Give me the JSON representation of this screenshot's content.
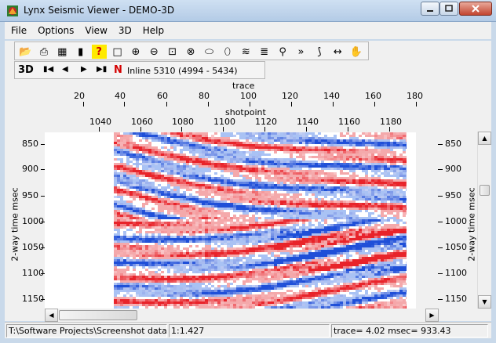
{
  "window": {
    "title": "Lynx Seismic Viewer - DEMO-3D"
  },
  "menu": [
    "File",
    "Options",
    "View",
    "3D",
    "Help"
  ],
  "toolbar": {
    "buttons": [
      "open-icon",
      "print-icon",
      "export-icon",
      "colorbar-icon",
      "help-icon",
      "new-window-icon",
      "zoom-in-icon",
      "zoom-out-icon",
      "zoom-box-icon",
      "zoom-cancel-icon",
      "pan-horizontal-icon",
      "pan-vertical-icon",
      "wiggle-icon",
      "stack-icon",
      "magnify-icon",
      "fast-forward-icon",
      "wave-icon",
      "stretch-icon",
      "hand-icon"
    ],
    "three_d_label": "3D",
    "n_label": "N",
    "inline_label": "Inline 5310 (4994 - 5434)"
  },
  "axes": {
    "top_title": "trace",
    "top_ticks": [
      "20",
      "40",
      "60",
      "80",
      "100",
      "120",
      "140",
      "160",
      "180"
    ],
    "mid_title": "shotpoint",
    "mid_ticks": [
      "1040",
      "1060",
      "1080",
      "1100",
      "1120",
      "1140",
      "1160",
      "1180"
    ],
    "y_title": "2-way time msec",
    "y_ticks": [
      "850",
      "900",
      "950",
      "1000",
      "1050",
      "1100",
      "1150"
    ]
  },
  "status": {
    "path": "T:\\Software Projects\\Screenshot data\\I",
    "scale": "1:1.427",
    "readout": "trace=     4.02 msec=   933.43"
  },
  "colors": {
    "positive": "#e8232a",
    "negative": "#1f4fd8",
    "background": "#ffffff"
  }
}
